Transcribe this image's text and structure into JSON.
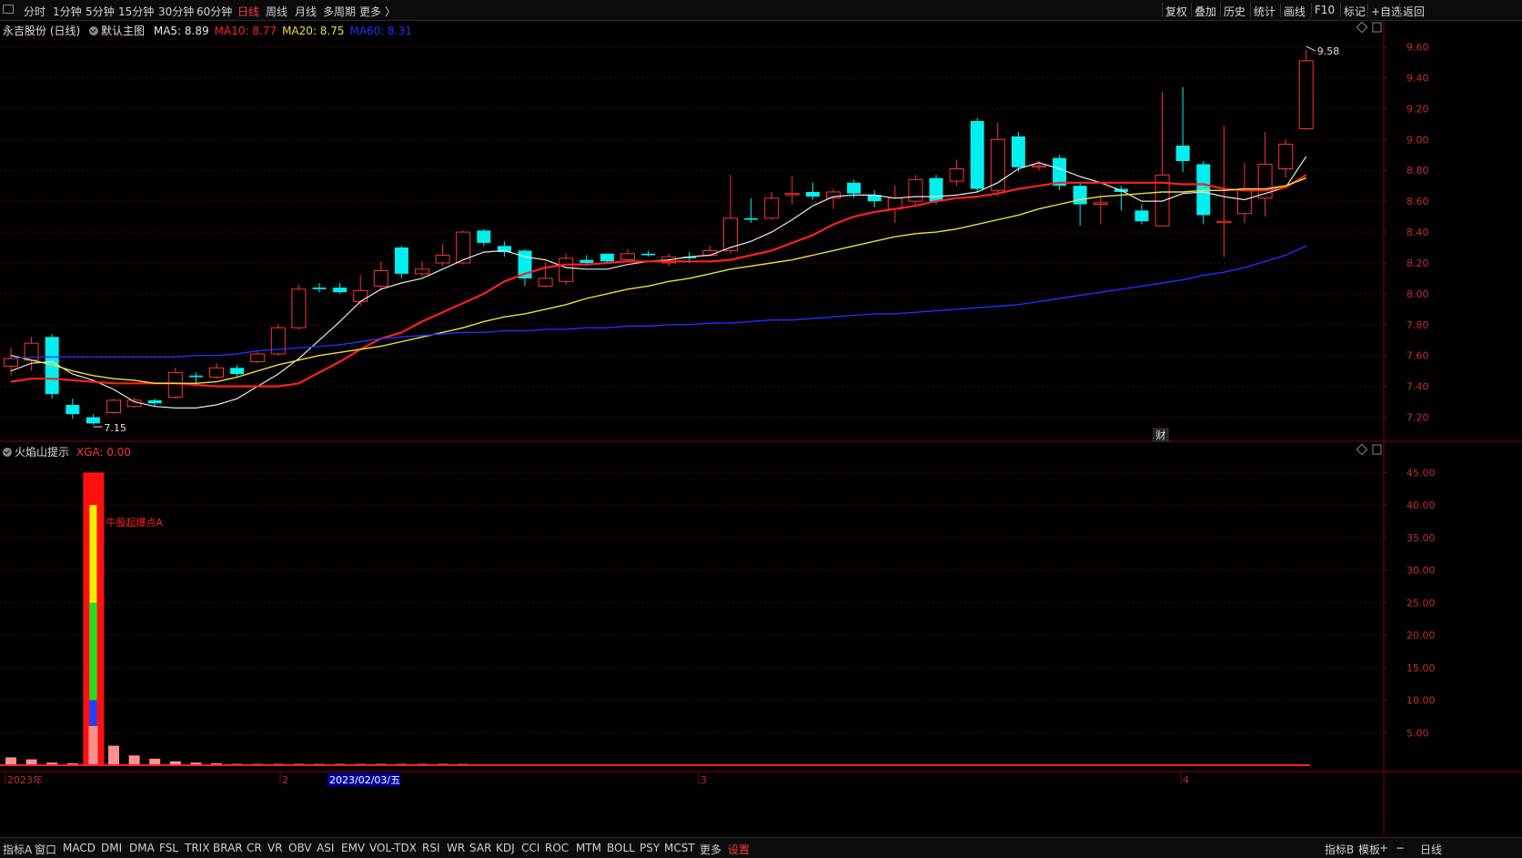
{
  "toolbar": {
    "periods": [
      "分时",
      "1分钟",
      "5分钟",
      "15分钟",
      "30分钟",
      "60分钟",
      "日线",
      "周线",
      "月线",
      "多周期",
      "更多 〉"
    ],
    "active_period": "日线",
    "right_tools": [
      "复权",
      "叠加",
      "历史",
      "统计",
      "画线",
      "F10",
      "标记",
      "+自选",
      "返回"
    ]
  },
  "main_panel": {
    "title": "永吉股份 (日线)",
    "template": "默认主图",
    "ma": [
      {
        "label": "MA5: 8.89",
        "color": "#e8e8e8"
      },
      {
        "label": "MA10: 8.77",
        "color": "#ff2020"
      },
      {
        "label": "MA20: 8.75",
        "color": "#e8e040"
      },
      {
        "label": "MA60: 8.31",
        "color": "#2030ff"
      }
    ],
    "high_label": "9.58",
    "low_label": "7.15",
    "marker_cai": "财"
  },
  "sub_panel": {
    "title": "火焰山提示",
    "value_label": "XGA: 0.00",
    "annotation": "牛股起爆点A"
  },
  "x_axis": {
    "labels": [
      "2023年",
      "2",
      "2023/02/03/五",
      "3",
      "4"
    ]
  },
  "bottom_bar": {
    "left_items": [
      "指标A",
      "窗口",
      "MACD",
      "DMI",
      "DMA",
      "FSL",
      "TRIX",
      "BRAR",
      "CR",
      "VR",
      "OBV",
      "ASI",
      "EMV",
      "VOL-TDX",
      "RSI",
      "WR",
      "SAR",
      "KDJ",
      "CCI",
      "ROC",
      "MTM",
      "BOLL",
      "PSY",
      "MCST",
      "更多",
      "设置"
    ],
    "right_items": [
      "指标B",
      "模板",
      "+",
      "−",
      "日线"
    ]
  },
  "colors": {
    "up": "#ff3232",
    "down": "#00f0f0",
    "ma5": "#e8e8e8",
    "ma10": "#ff2020",
    "ma20": "#e8e040",
    "ma60": "#2030ff"
  },
  "chart_data": [
    {
      "type": "candlestick",
      "title": "永吉股份 (日线)",
      "y_ticks": [
        "9.60",
        "9.40",
        "9.20",
        "9.00",
        "8.80",
        "8.60",
        "8.40",
        "8.20",
        "8.00",
        "7.80",
        "7.60",
        "7.40",
        "7.20"
      ],
      "ylim": [
        7.05,
        9.68
      ],
      "candles": [
        [
          7.53,
          7.58,
          7.65,
          7.47
        ],
        [
          7.57,
          7.68,
          7.72,
          7.5
        ],
        [
          7.72,
          7.35,
          7.74,
          7.32
        ],
        [
          7.28,
          7.22,
          7.32,
          7.19
        ],
        [
          7.2,
          7.16,
          7.22,
          7.15
        ],
        [
          7.23,
          7.31,
          7.32,
          7.22
        ],
        [
          7.27,
          7.31,
          7.33,
          7.26
        ],
        [
          7.31,
          7.29,
          7.32,
          7.27
        ],
        [
          7.33,
          7.49,
          7.52,
          7.32
        ],
        [
          7.47,
          7.46,
          7.49,
          7.42
        ],
        [
          7.46,
          7.52,
          7.55,
          7.45
        ],
        [
          7.52,
          7.48,
          7.54,
          7.46
        ],
        [
          7.56,
          7.61,
          7.63,
          7.55
        ],
        [
          7.61,
          7.78,
          7.8,
          7.6
        ],
        [
          7.78,
          8.03,
          8.06,
          7.77
        ],
        [
          8.04,
          8.03,
          8.07,
          8.01
        ],
        [
          8.04,
          8.01,
          8.07,
          8.0
        ],
        [
          7.95,
          8.02,
          8.12,
          7.92
        ],
        [
          8.05,
          8.15,
          8.21,
          8.03
        ],
        [
          8.3,
          8.13,
          8.31,
          8.1
        ],
        [
          8.13,
          8.16,
          8.21,
          8.11
        ],
        [
          8.2,
          8.25,
          8.32,
          8.18
        ],
        [
          8.2,
          8.4,
          8.41,
          8.19
        ],
        [
          8.41,
          8.33,
          8.42,
          8.31
        ],
        [
          8.31,
          8.27,
          8.34,
          8.24
        ],
        [
          8.28,
          8.1,
          8.29,
          8.05
        ],
        [
          8.05,
          8.1,
          8.2,
          8.04
        ],
        [
          8.08,
          8.23,
          8.26,
          8.06
        ],
        [
          8.22,
          8.2,
          8.25,
          8.18
        ],
        [
          8.26,
          8.21,
          8.25,
          8.2
        ],
        [
          8.22,
          8.26,
          8.29,
          8.21
        ],
        [
          8.26,
          8.25,
          8.28,
          8.24
        ],
        [
          8.2,
          8.24,
          8.26,
          8.18
        ],
        [
          8.24,
          8.23,
          8.27,
          8.2
        ],
        [
          8.25,
          8.28,
          8.31,
          8.24
        ],
        [
          8.28,
          8.49,
          8.77,
          8.26
        ],
        [
          8.49,
          8.48,
          8.62,
          8.46
        ],
        [
          8.49,
          8.62,
          8.66,
          8.48
        ],
        [
          8.65,
          8.65,
          8.76,
          8.58
        ],
        [
          8.66,
          8.63,
          8.72,
          8.61
        ],
        [
          8.62,
          8.66,
          8.68,
          8.55
        ],
        [
          8.72,
          8.65,
          8.74,
          8.62
        ],
        [
          8.64,
          8.6,
          8.67,
          8.56
        ],
        [
          8.55,
          8.62,
          8.7,
          8.46
        ],
        [
          8.6,
          8.74,
          8.77,
          8.58
        ],
        [
          8.75,
          8.6,
          8.77,
          8.58
        ],
        [
          8.73,
          8.81,
          8.87,
          8.7
        ],
        [
          9.12,
          8.68,
          9.14,
          8.66
        ],
        [
          8.67,
          9.0,
          9.11,
          8.63
        ],
        [
          9.02,
          8.82,
          9.05,
          8.79
        ],
        [
          8.83,
          8.83,
          8.86,
          8.8
        ],
        [
          8.88,
          8.7,
          8.9,
          8.67
        ],
        [
          8.7,
          8.58,
          8.72,
          8.44
        ],
        [
          8.58,
          8.59,
          8.63,
          8.45
        ],
        [
          8.68,
          8.66,
          8.7,
          8.54
        ],
        [
          8.54,
          8.47,
          8.58,
          8.45
        ],
        [
          8.44,
          8.77,
          9.31,
          8.44
        ],
        [
          8.96,
          8.86,
          9.34,
          8.79
        ],
        [
          8.84,
          8.51,
          8.86,
          8.45
        ],
        [
          8.47,
          8.47,
          9.09,
          8.24
        ],
        [
          8.52,
          8.68,
          8.85,
          8.46
        ],
        [
          8.62,
          8.84,
          9.05,
          8.5
        ],
        [
          8.81,
          8.97,
          9.0,
          8.75
        ],
        [
          9.07,
          9.51,
          9.58,
          9.06
        ]
      ],
      "series": [
        {
          "name": "MA5",
          "values": [
            7.5,
            7.55,
            7.56,
            7.48,
            7.44,
            7.38,
            7.3,
            7.27,
            7.26,
            7.26,
            7.28,
            7.32,
            7.4,
            7.48,
            7.58,
            7.7,
            7.82,
            7.95,
            8.03,
            8.07,
            8.1,
            8.16,
            8.22,
            8.27,
            8.28,
            8.24,
            8.22,
            8.17,
            8.16,
            8.16,
            8.19,
            8.21,
            8.22,
            8.24,
            8.25,
            8.3,
            8.34,
            8.4,
            8.48,
            8.57,
            8.63,
            8.64,
            8.64,
            8.62,
            8.63,
            8.63,
            8.64,
            8.66,
            8.72,
            8.81,
            8.85,
            8.81,
            8.76,
            8.72,
            8.67,
            8.6,
            8.6,
            8.65,
            8.66,
            8.63,
            8.61,
            8.65,
            8.69,
            8.89
          ]
        },
        {
          "name": "MA10",
          "values": [
            7.43,
            7.45,
            7.45,
            7.44,
            7.43,
            7.42,
            7.42,
            7.42,
            7.42,
            7.41,
            7.4,
            7.4,
            7.4,
            7.4,
            7.42,
            7.49,
            7.56,
            7.64,
            7.71,
            7.75,
            7.82,
            7.88,
            7.94,
            8.0,
            8.08,
            8.13,
            8.17,
            8.19,
            8.19,
            8.2,
            8.21,
            8.21,
            8.21,
            8.21,
            8.21,
            8.22,
            8.25,
            8.28,
            8.33,
            8.38,
            8.45,
            8.5,
            8.53,
            8.55,
            8.57,
            8.6,
            8.62,
            8.63,
            8.65,
            8.68,
            8.7,
            8.72,
            8.72,
            8.72,
            8.72,
            8.72,
            8.72,
            8.71,
            8.71,
            8.68,
            8.67,
            8.67,
            8.69,
            8.77
          ]
        },
        {
          "name": "MA20",
          "values": [
            7.6,
            7.57,
            7.54,
            7.5,
            7.47,
            7.45,
            7.44,
            7.42,
            7.42,
            7.42,
            7.43,
            7.46,
            7.5,
            7.54,
            7.57,
            7.6,
            7.62,
            7.64,
            7.66,
            7.69,
            7.72,
            7.75,
            7.78,
            7.82,
            7.85,
            7.87,
            7.9,
            7.93,
            7.97,
            8.0,
            8.03,
            8.05,
            8.08,
            8.1,
            8.13,
            8.16,
            8.18,
            8.2,
            8.22,
            8.25,
            8.28,
            8.31,
            8.34,
            8.37,
            8.39,
            8.4,
            8.42,
            8.45,
            8.48,
            8.51,
            8.55,
            8.58,
            8.61,
            8.63,
            8.64,
            8.65,
            8.66,
            8.66,
            8.67,
            8.67,
            8.68,
            8.68,
            8.7,
            8.75
          ]
        },
        {
          "name": "MA60",
          "values": [
            7.58,
            7.59,
            7.59,
            7.59,
            7.59,
            7.59,
            7.59,
            7.59,
            7.59,
            7.6,
            7.6,
            7.61,
            7.63,
            7.64,
            7.65,
            7.66,
            7.67,
            7.69,
            7.71,
            7.72,
            7.73,
            7.74,
            7.75,
            7.75,
            7.76,
            7.76,
            7.77,
            7.77,
            7.78,
            7.78,
            7.79,
            7.79,
            7.8,
            7.8,
            7.81,
            7.81,
            7.82,
            7.83,
            7.83,
            7.84,
            7.85,
            7.86,
            7.87,
            7.87,
            7.88,
            7.89,
            7.9,
            7.91,
            7.92,
            7.93,
            7.95,
            7.97,
            7.99,
            8.01,
            8.03,
            8.05,
            8.07,
            8.09,
            8.12,
            8.14,
            8.17,
            8.21,
            8.25,
            8.31
          ]
        }
      ]
    },
    {
      "type": "bar",
      "title": "火焰山提示",
      "y_ticks": [
        "45.00",
        "40.00",
        "35.00",
        "30.00",
        "25.00",
        "20.00",
        "15.00",
        "10.00",
        "5.00"
      ],
      "ylim": [
        0,
        47
      ],
      "values": [
        1.2,
        0.9,
        0.4,
        0.3,
        45,
        3.0,
        1.5,
        1.0,
        0.6,
        0.4,
        0.3,
        0.2,
        0.2,
        0.2,
        0.2,
        0.2,
        0.2,
        0.2,
        0.2,
        0.2,
        0.2,
        0.2,
        0.2
      ],
      "overlay_bands": [
        {
          "name": "yellow",
          "from": 10,
          "to": 40
        },
        {
          "name": "green",
          "from": 10,
          "to": 25
        },
        {
          "name": "blue",
          "from": 6,
          "to": 10
        }
      ]
    }
  ]
}
